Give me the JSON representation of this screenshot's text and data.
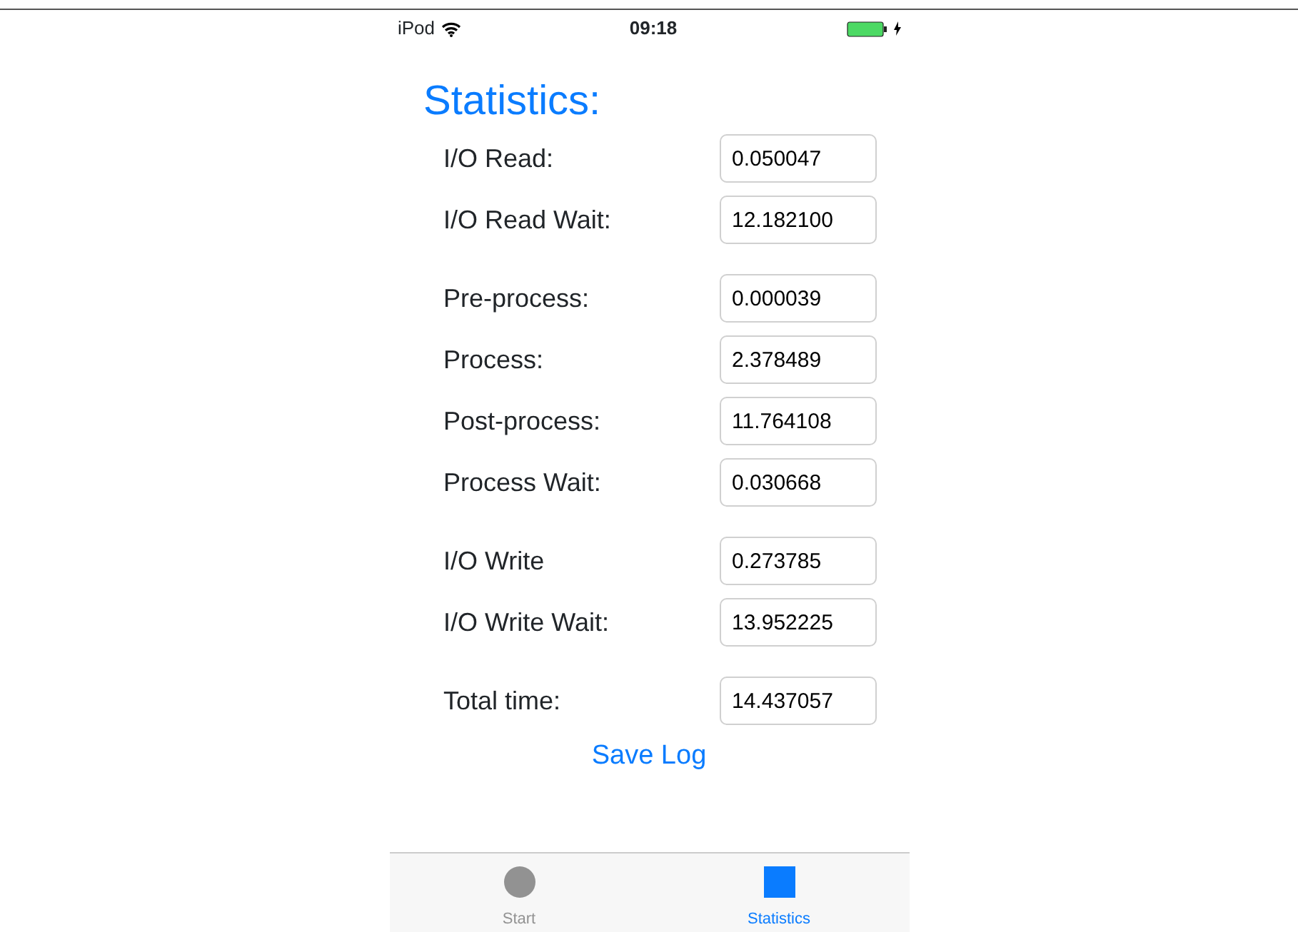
{
  "status_bar": {
    "carrier": "iPod",
    "time": "09:18",
    "charging": true
  },
  "title": "Statistics:",
  "groups": [
    {
      "rows": [
        {
          "label": "I/O Read:",
          "value": "0.050047"
        },
        {
          "label": "I/O Read Wait:",
          "value": "12.182100"
        }
      ]
    },
    {
      "rows": [
        {
          "label": "Pre-process:",
          "value": "0.000039"
        },
        {
          "label": "Process:",
          "value": "2.378489"
        },
        {
          "label": "Post-process:",
          "value": "11.764108"
        },
        {
          "label": "Process Wait:",
          "value": "0.030668"
        }
      ]
    },
    {
      "rows": [
        {
          "label": "I/O Write",
          "value": "0.273785"
        },
        {
          "label": "I/O Write Wait:",
          "value": "13.952225"
        }
      ]
    },
    {
      "rows": [
        {
          "label": "Total time:",
          "value": "14.437057"
        }
      ]
    }
  ],
  "save_button": "Save Log",
  "tabs": [
    {
      "label": "Start",
      "selected": false
    },
    {
      "label": "Statistics",
      "selected": true
    }
  ]
}
